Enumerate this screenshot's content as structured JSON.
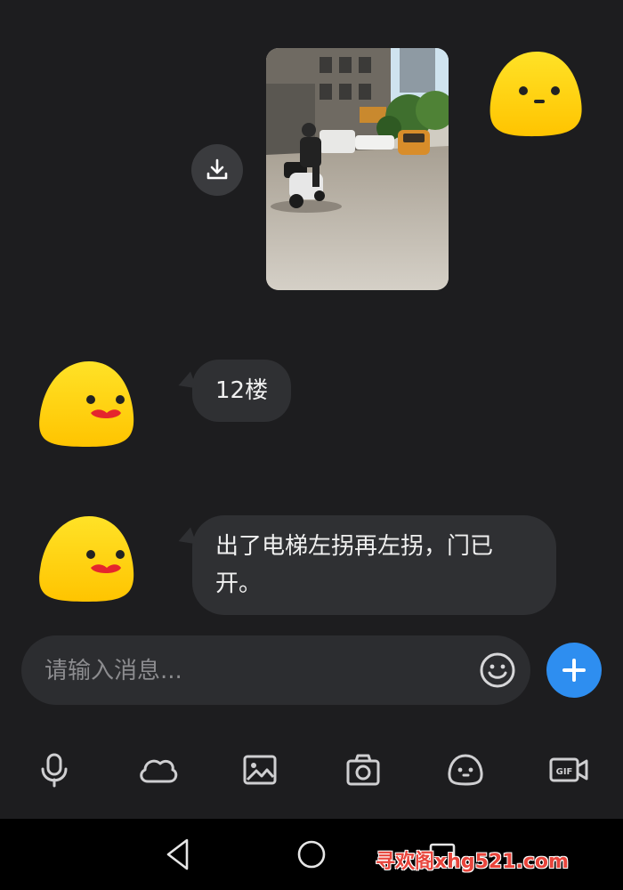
{
  "messages": [
    {
      "type": "image",
      "sender": "me"
    },
    {
      "type": "text",
      "sender": "other",
      "text": "12楼"
    },
    {
      "type": "text",
      "sender": "other",
      "text": "出了电梯左拐再左拐，门已开。"
    }
  ],
  "composer": {
    "placeholder": "请输入消息..."
  },
  "toolbar": {
    "items": [
      "mic-icon",
      "cloud-icon",
      "image-icon",
      "camera-icon",
      "sticker-icon",
      "gif-icon"
    ]
  },
  "navbar": {
    "items": [
      "back-icon",
      "home-icon",
      "recent-apps-icon"
    ]
  },
  "watermark": {
    "text": "寻欢阁xhg521.com"
  },
  "colors": {
    "background": "#1d1d1f",
    "bubble": "#2f3033",
    "accent": "#2e8ef0",
    "avatar_yellow": "#ffd21a",
    "watermark": "#e8453c"
  }
}
